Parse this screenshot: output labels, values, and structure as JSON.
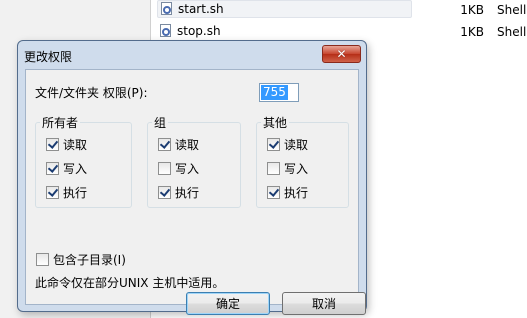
{
  "background": {
    "files": [
      {
        "name": "start.sh",
        "size": "1KB",
        "type": "Shell",
        "selected": true
      },
      {
        "name": "stop.sh",
        "size": "1KB",
        "type": "Shell",
        "selected": false
      }
    ]
  },
  "dialog": {
    "title": "更改权限",
    "close_icon": "close-icon",
    "permission_label": "文件/文件夹 权限(P):",
    "permission_value": "755",
    "groups": [
      {
        "label": "所有者",
        "items": [
          {
            "label": "读取",
            "checked": true
          },
          {
            "label": "写入",
            "checked": true
          },
          {
            "label": "执行",
            "checked": true
          }
        ]
      },
      {
        "label": "组",
        "items": [
          {
            "label": "读取",
            "checked": true
          },
          {
            "label": "写入",
            "checked": false
          },
          {
            "label": "执行",
            "checked": true
          }
        ]
      },
      {
        "label": "其他",
        "items": [
          {
            "label": "读取",
            "checked": true
          },
          {
            "label": "写入",
            "checked": false
          },
          {
            "label": "执行",
            "checked": true
          }
        ]
      }
    ],
    "recurse_label": "包含子目录(I)",
    "recurse_checked": false,
    "note": "此命令仅在部分UNIX 主机中适用。",
    "ok_label": "确定",
    "cancel_label": "取消"
  },
  "colors": {
    "selection_highlight": "#3399ff",
    "close_button": "#c7452f",
    "dialog_frame": "#cfdcec"
  }
}
